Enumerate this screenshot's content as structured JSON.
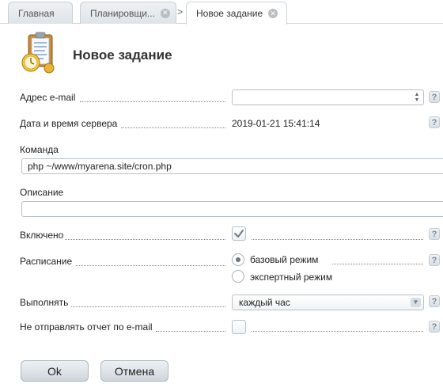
{
  "tabs": [
    {
      "label": "Главная"
    },
    {
      "label": "Планировщи..."
    },
    {
      "label": "Новое задание"
    }
  ],
  "tab_separator": ">",
  "page": {
    "title": "Новое задание"
  },
  "form": {
    "email": {
      "label": "Адрес e-mail",
      "value": ""
    },
    "server_time": {
      "label": "Дата и время сервера",
      "value": "2019-01-21 15:41:14"
    },
    "command": {
      "label": "Команда",
      "value": "php ~/www/myarena.site/cron.php"
    },
    "description": {
      "label": "Описание",
      "value": ""
    },
    "enabled": {
      "label": "Включено",
      "checked": true
    },
    "schedule": {
      "label": "Расписание",
      "options": [
        {
          "label": "базовый режим",
          "checked": true
        },
        {
          "label": "экспертный режим",
          "checked": false
        }
      ]
    },
    "execute": {
      "label": "Выполнять",
      "selected": "каждый час"
    },
    "no_email_report": {
      "label": "Не отправлять отчет по e-mail",
      "checked": false
    }
  },
  "help_glyph": "?",
  "buttons": {
    "ok": "Ok",
    "cancel": "Отмена"
  },
  "icons": {
    "title": "task-clipboard-clock-icon",
    "tab_close": "close-circle-icon",
    "checkmark": "checkmark-icon",
    "help": "help-icon",
    "dropdown": "chevron-down-icon"
  }
}
